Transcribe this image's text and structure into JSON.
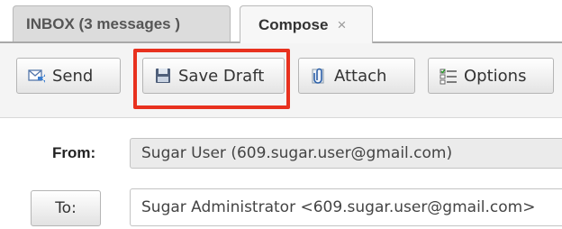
{
  "tabs": {
    "inbox_label": "INBOX (3 messages )",
    "compose_label": "Compose",
    "close_glyph": "×"
  },
  "toolbar": {
    "send_label": "Send",
    "save_draft_label": "Save Draft",
    "attach_label": "Attach",
    "options_label": "Options",
    "highlight_color": "#e8311e"
  },
  "form": {
    "from_label": "From:",
    "from_value": "Sugar User (609.sugar.user@gmail.com)",
    "to_button_label": "To:",
    "to_value": "Sugar Administrator <609.sugar.user@gmail.com>"
  }
}
